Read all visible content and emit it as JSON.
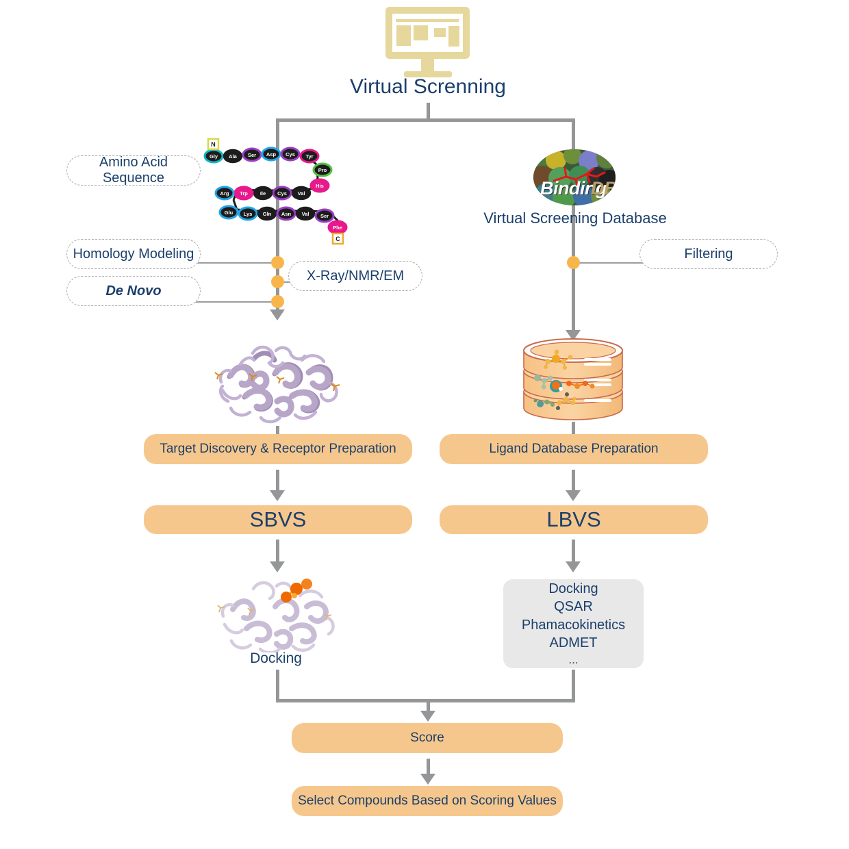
{
  "title": {
    "label": "Virtual Screnning",
    "icon": "monitor-icon"
  },
  "colors": {
    "accent_orange": "#F6C78C",
    "dot_orange": "#F7B54A",
    "text_navy": "#1b3f6b",
    "connector_gray": "#949698",
    "gray_box": "#e8e8e8",
    "monitor_khaki": "#E6D79C",
    "protein_purple": "#B8A6C9"
  },
  "left_branch": {
    "sequence_pill": "Amino Acid Sequence",
    "homology_pill": "Homology Modeling",
    "denovo_pill": "De Novo",
    "xray_pill": "X-Ray/NMR/EM",
    "sequence_terminus_n": "N",
    "sequence_terminus_c": "C",
    "residues_row1": [
      "Gly",
      "Ala",
      "Ser",
      "Asp",
      "Cys",
      "Tyr"
    ],
    "residues_turn1": [
      "Pro",
      "His"
    ],
    "residues_row2": [
      "Arg",
      "Trp",
      "Ile",
      "Cys",
      "Val"
    ],
    "residues_row3": [
      "Glu",
      "Lys",
      "Gln",
      "Asn",
      "Val",
      "Ser",
      "Phe"
    ],
    "protein_image_alt": "protein-ribbon-structure",
    "prep_box": "Target Discovery & Receptor Preparation",
    "method_box": "SBVS",
    "docking_image_alt": "protein-ligand-docking-structure",
    "docking_caption": "Docking"
  },
  "right_branch": {
    "logo_primary": "Binding",
    "logo_secondary": "DB",
    "logo_caption": "Virtual Screening Database",
    "filtering_pill": "Filtering",
    "database_image_alt": "ligand-database-cylinder",
    "prep_box": "Ligand Database Preparation",
    "method_box": "LBVS",
    "methods_list": [
      "Docking",
      "QSAR",
      "Phamacokinetics",
      "ADMET",
      "..."
    ]
  },
  "footer": {
    "score_box": "Score",
    "select_box": "Select Compounds Based on Scoring Values"
  }
}
